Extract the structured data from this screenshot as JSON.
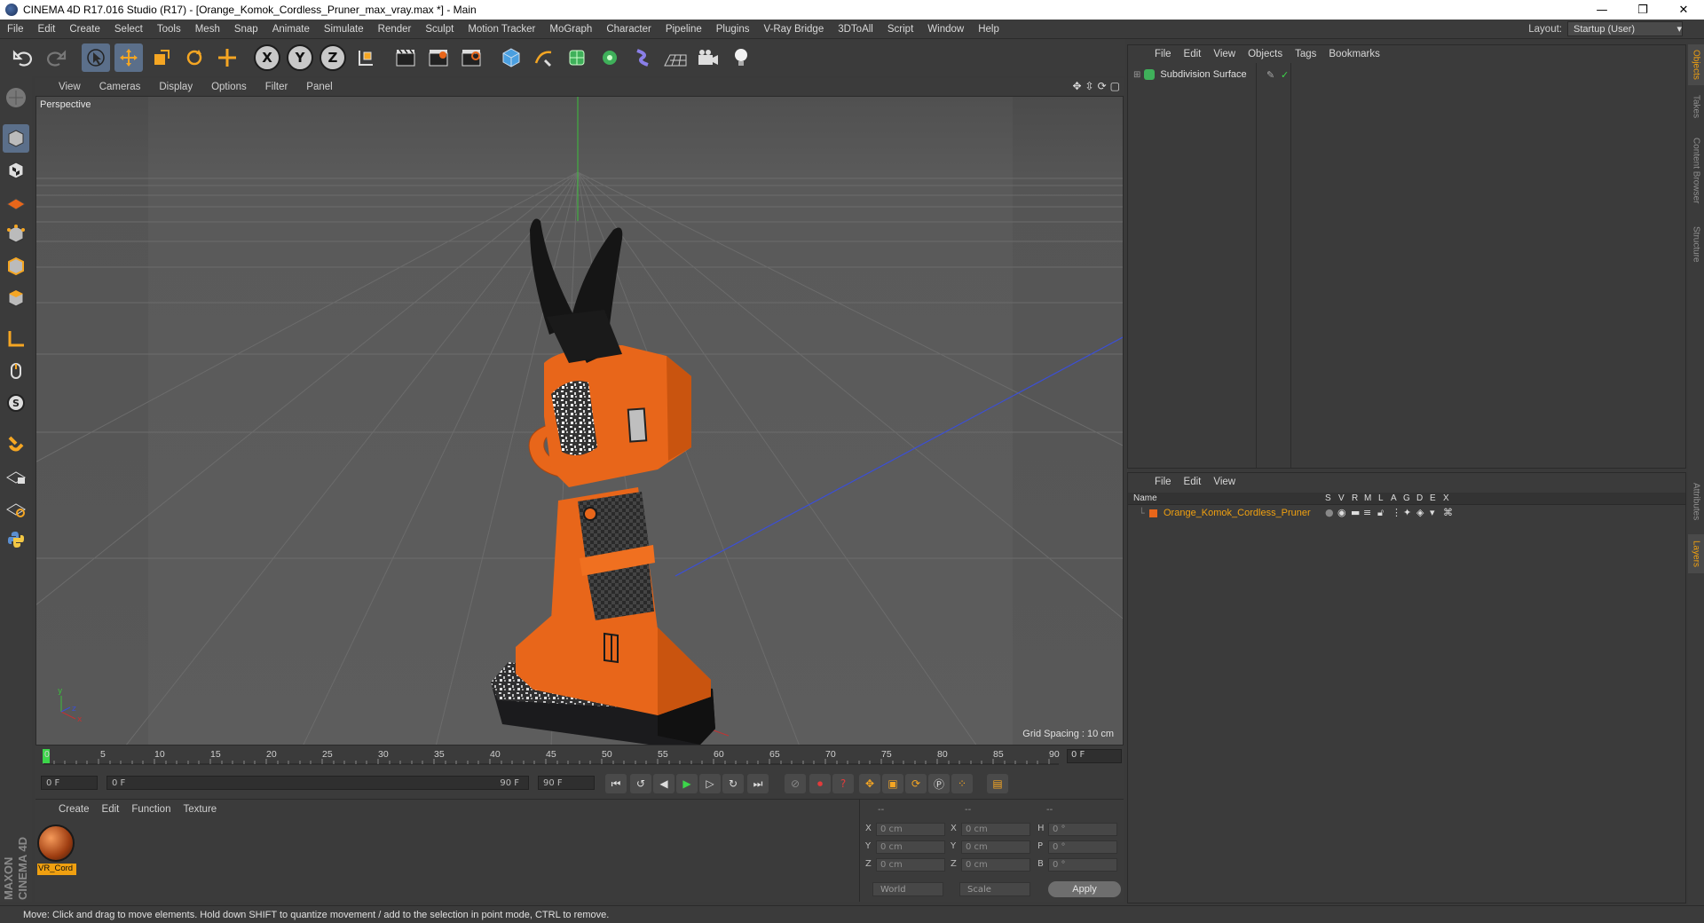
{
  "window": {
    "title": "CINEMA 4D R17.016 Studio (R17) - [Orange_Komok_Cordless_Pruner_max_vray.max *] - Main",
    "minimize": "—",
    "restore": "❐",
    "close": "✕"
  },
  "menubar": {
    "items": [
      "File",
      "Edit",
      "Create",
      "Select",
      "Tools",
      "Mesh",
      "Snap",
      "Animate",
      "Simulate",
      "Render",
      "Sculpt",
      "Motion Tracker",
      "MoGraph",
      "Character",
      "Pipeline",
      "Plugins",
      "V-Ray Bridge",
      "3DToAll",
      "Script",
      "Window",
      "Help"
    ],
    "layout_label": "Layout:",
    "layout_value": "Startup (User)"
  },
  "toolbar": {
    "x_axis": "X",
    "y_axis": "Y",
    "z_axis": "Z"
  },
  "viewport": {
    "menu": [
      "View",
      "Cameras",
      "Display",
      "Options",
      "Filter",
      "Panel"
    ],
    "label": "Perspective",
    "grid_spacing": "Grid Spacing : 10 cm"
  },
  "timeline": {
    "ticks": [
      "0",
      "5",
      "10",
      "15",
      "20",
      "25",
      "30",
      "35",
      "40",
      "45",
      "50",
      "55",
      "60",
      "65",
      "70",
      "75",
      "80",
      "85",
      "90"
    ],
    "current_frame": "0 F",
    "start_field": "0 F",
    "range_start": "0 F",
    "range_end": "90 F",
    "end_field": "90 F"
  },
  "material_manager": {
    "menu": [
      "Create",
      "Edit",
      "Function",
      "Texture"
    ],
    "material_name": "VR_Cord"
  },
  "coordinates": {
    "headers": [
      "--",
      "--",
      "--"
    ],
    "rows": [
      {
        "a": "X",
        "av": "0 cm",
        "b": "X",
        "bv": "0 cm",
        "c": "H",
        "cv": "0 °"
      },
      {
        "a": "Y",
        "av": "0 cm",
        "b": "Y",
        "bv": "0 cm",
        "c": "P",
        "cv": "0 °"
      },
      {
        "a": "Z",
        "av": "0 cm",
        "b": "Z",
        "bv": "0 cm",
        "c": "B",
        "cv": "0 °"
      }
    ],
    "world": "World",
    "scale": "Scale",
    "apply": "Apply"
  },
  "object_manager": {
    "menu": [
      "File",
      "Edit",
      "View",
      "Objects",
      "Tags",
      "Bookmarks"
    ],
    "objects": [
      {
        "name": "Subdivision Surface"
      }
    ]
  },
  "layer_manager": {
    "menu": [
      "File",
      "Edit",
      "View"
    ],
    "name_header": "Name",
    "columns": [
      "S",
      "V",
      "R",
      "M",
      "L",
      "A",
      "G",
      "D",
      "E",
      "X"
    ],
    "layers": [
      {
        "name": "Orange_Komok_Cordless_Pruner"
      }
    ]
  },
  "side_tabs": [
    "Objects",
    "Takes",
    "Content Browser",
    "Structure",
    "Attributes",
    "Layers"
  ],
  "statusbar": {
    "text": "Move: Click and drag to move elements. Hold down SHIFT to quantize movement / add to the selection in point mode, CTRL to remove."
  },
  "colors": {
    "accent": "#f0a010",
    "active_tool": "#5b6f8a",
    "pruner_orange": "#e8661a"
  }
}
